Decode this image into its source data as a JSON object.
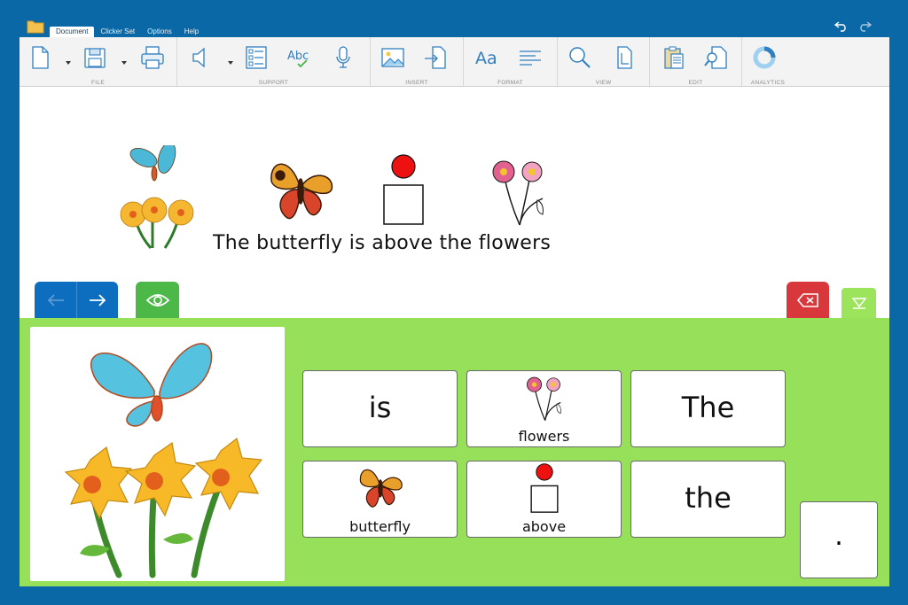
{
  "menu": {
    "tabs": [
      "Document",
      "Clicker Set",
      "Options",
      "Help"
    ],
    "active_tab": "Document"
  },
  "ribbon": {
    "groups": [
      "FILE",
      "SUPPORT",
      "INSERT",
      "FORMAT",
      "VIEW",
      "EDIT",
      "ANALYTICS"
    ],
    "format_glyph": "Aa",
    "spell_glyph": "Abc"
  },
  "document": {
    "sentence": "The butterfly is above the flowers"
  },
  "grid": {
    "cells": [
      {
        "word": "is"
      },
      {
        "word": "flowers"
      },
      {
        "word": "The"
      },
      {
        "word": "butterfly"
      },
      {
        "word": "above"
      },
      {
        "word": "the"
      }
    ],
    "period": "."
  },
  "colors": {
    "frame": "#0a68a6",
    "panel": "#96e05a",
    "nav": "#0d6ec0",
    "eye": "#4cb848",
    "delete": "#d8373c"
  }
}
